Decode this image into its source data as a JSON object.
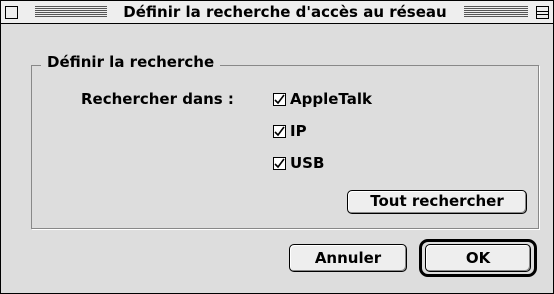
{
  "window": {
    "title": "Définir la recherche d'accès au réseau"
  },
  "group": {
    "legend": "Définir la recherche",
    "search_in_label": "Rechercher dans :",
    "options": [
      {
        "label": "AppleTalk",
        "checked": true
      },
      {
        "label": "IP",
        "checked": true
      },
      {
        "label": "USB",
        "checked": true
      }
    ],
    "search_all_label": "Tout rechercher"
  },
  "buttons": {
    "cancel_label": "Annuler",
    "ok_label": "OK"
  },
  "colors": {
    "window_bg": "#dddddd",
    "titlebar_bg": "#eeeeee"
  }
}
